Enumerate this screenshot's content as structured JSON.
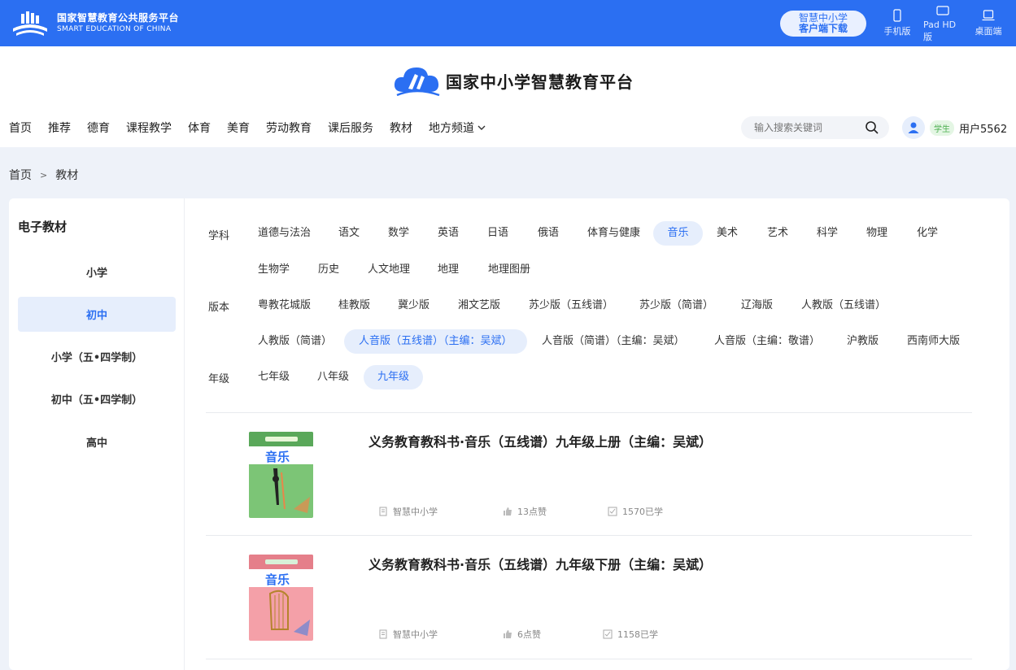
{
  "topbar": {
    "logo_cn": "国家智慧教育公共服务平台",
    "logo_en": "SMART EDUCATION OF CHINA",
    "download_line1": "智慧中小学",
    "download_line2": "客户端下载",
    "devices": [
      {
        "label": "手机版",
        "icon": "phone-icon"
      },
      {
        "label": "Pad HD版",
        "icon": "tablet-icon"
      },
      {
        "label": "桌面端",
        "icon": "laptop-icon"
      }
    ]
  },
  "header": {
    "brand": "国家中小学智慧教育平台",
    "nav": [
      "首页",
      "推荐",
      "德育",
      "课程教学",
      "体育",
      "美育",
      "劳动教育",
      "课后服务",
      "教材",
      "地方频道"
    ],
    "search_placeholder": "输入搜索关键词",
    "role": "学生",
    "username": "用户5562"
  },
  "breadcrumb": {
    "home": "首页",
    "sep": ">",
    "current": "教材"
  },
  "sidebar": {
    "title": "电子教材",
    "items": [
      "小学",
      "初中",
      "小学（五•四学制）",
      "初中（五•四学制）",
      "高中"
    ],
    "active_index": 1
  },
  "filters": {
    "subject_label": "学科",
    "subjects": [
      "道德与法治",
      "语文",
      "数学",
      "英语",
      "日语",
      "俄语",
      "体育与健康",
      "音乐",
      "美术",
      "艺术",
      "科学",
      "物理",
      "化学",
      "生物学",
      "历史",
      "人文地理",
      "地理",
      "地理图册"
    ],
    "subject_active": "音乐",
    "edition_label": "版本",
    "editions": [
      "粤教花城版",
      "桂教版",
      "冀少版",
      "湘文艺版",
      "苏少版（五线谱）",
      "苏少版（简谱）",
      "辽海版",
      "人教版（五线谱）",
      "人教版（简谱）",
      "人音版（五线谱）（主编：吴斌）",
      "人音版（简谱）（主编：吴斌）",
      "人音版（主编：敬谱）",
      "沪教版",
      "西南师大版"
    ],
    "edition_active": "人音版（五线谱）（主编：吴斌）",
    "grade_label": "年级",
    "grades": [
      "七年级",
      "八年级",
      "九年级"
    ],
    "grade_active": "九年级"
  },
  "books": [
    {
      "title": "义务教育教科书·音乐（五线谱）九年级上册（主编：吴斌）",
      "source": "智慧中小学",
      "likes": "13点赞",
      "learners": "1570已学",
      "cover_title": "音乐",
      "cover_color": "#7cc576"
    },
    {
      "title": "义务教育教科书·音乐（五线谱）九年级下册（主编：吴斌）",
      "source": "智慧中小学",
      "likes": "6点赞",
      "learners": "1158已学",
      "cover_title": "音乐",
      "cover_color": "#f4a0a8"
    }
  ]
}
